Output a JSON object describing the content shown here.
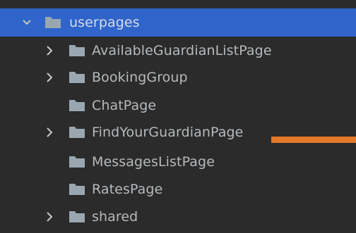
{
  "project_tree": {
    "root": {
      "label": "userpages",
      "icon": "folder-icon",
      "expanded": true
    },
    "children": [
      {
        "label": "AvailableGuardianListPage",
        "icon": "folder-icon",
        "expandable": true
      },
      {
        "label": "BookingGroup",
        "icon": "folder-icon",
        "expandable": true
      },
      {
        "label": "ChatPage",
        "icon": "folder-icon",
        "expandable": false
      },
      {
        "label": "FindYourGuardianPage",
        "icon": "folder-icon",
        "expandable": true
      },
      {
        "label": "MessagesListPage",
        "icon": "folder-icon",
        "expandable": false
      },
      {
        "label": "RatesPage",
        "icon": "folder-icon",
        "expandable": false
      },
      {
        "label": "shared",
        "icon": "folder-icon",
        "expandable": true
      }
    ]
  },
  "colors": {
    "background": "#2b2b2b",
    "selection": "#2f65ca",
    "text": "#b6babd",
    "folder": "#9aa7b0",
    "chevron": "#c8c8c8",
    "annotation_line": "#e5792a"
  }
}
